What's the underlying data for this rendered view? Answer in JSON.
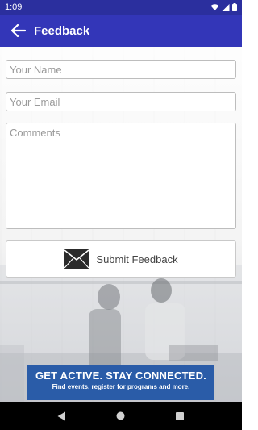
{
  "status_bar": {
    "time": "1:09",
    "icons": [
      "wifi-icon",
      "signal-icon",
      "battery-icon"
    ]
  },
  "app_bar": {
    "title": "Feedback",
    "back_icon": "arrow-left-icon",
    "background_color": "#3336b8"
  },
  "form": {
    "name_placeholder": "Your Name",
    "email_placeholder": "Your Email",
    "comments_placeholder": "Comments",
    "name_value": "",
    "email_value": "",
    "comments_value": "",
    "submit_label": "Submit Feedback",
    "submit_icon": "envelope-icon"
  },
  "banner": {
    "headline": "GET ACTIVE.  STAY CONNECTED.",
    "subtext": "Find events, register for programs and more.",
    "background_color": "#2a5ca8"
  },
  "nav_bar": {
    "buttons": [
      "back-triangle-icon",
      "home-circle-icon",
      "recents-square-icon"
    ]
  }
}
